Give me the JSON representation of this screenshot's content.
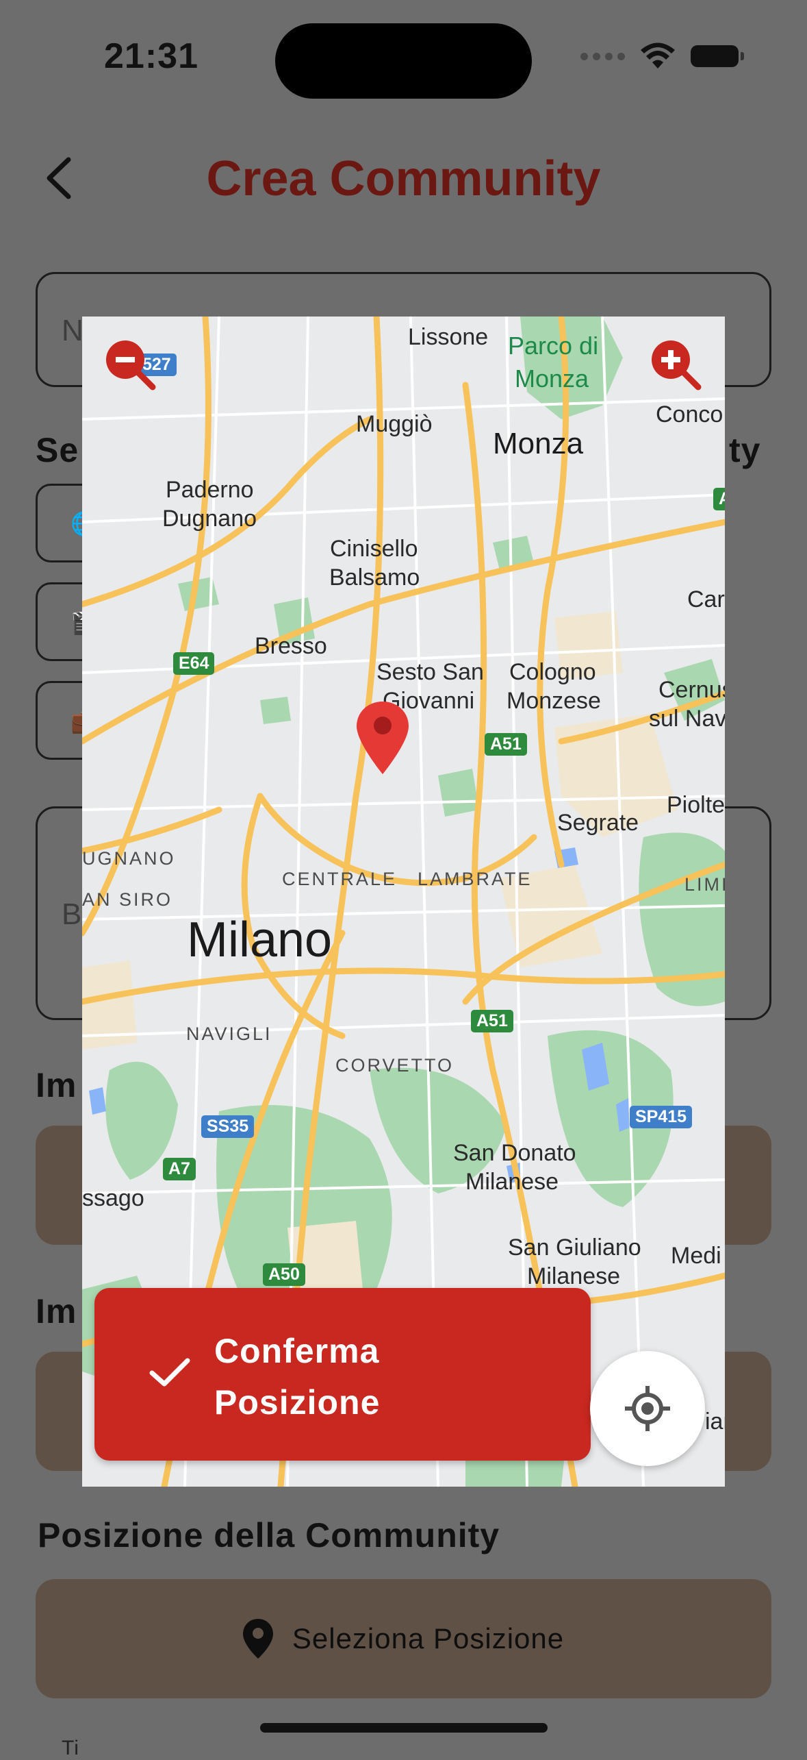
{
  "status_bar": {
    "time": "21:31"
  },
  "header": {
    "title": "Crea Community"
  },
  "form": {
    "name_placeholder": "N",
    "section_category_left": "Se",
    "section_category_right": "ty",
    "description_placeholder": "B",
    "section_image1": "Im",
    "section_image2": "Im",
    "section_position": "Posizione della Community",
    "select_position_label": "Seleziona Posizione",
    "bottom_partial": "Ti"
  },
  "map": {
    "labels": {
      "lissone": "Lissone",
      "parco1": "Parco di",
      "parco2": "Monza",
      "muggio": "Muggiò",
      "monza": "Monza",
      "conco": "Conco",
      "paderno1": "Paderno",
      "paderno2": "Dugnano",
      "cinisello1": "Cinisello",
      "cinisello2": "Balsamo",
      "car": "Car",
      "bresso": "Bresso",
      "sesto1": "Sesto San",
      "sesto2": "Giovanni",
      "cologno1": "Cologno",
      "cologno2": "Monzese",
      "cernus1": "Cernus",
      "cernus2": "sul Nav",
      "pioltello": "Piolte",
      "segrate": "Segrate",
      "ugnano": "UGNANO",
      "siro": "AN SIRO",
      "centrale": "CENTRALE",
      "lambrate": "LAMBRATE",
      "lim": "LIMI",
      "milano": "Milano",
      "navigli": "NAVIGLI",
      "corvetto": "CORVETTO",
      "donato1": "San Donato",
      "donato2": "Milanese",
      "assago": "ssago",
      "giuliano1": "San Giuliano",
      "giuliano2": "Milanese",
      "medi": "Medi",
      "ian": "ian"
    },
    "shields": {
      "e64": "E64",
      "a51a": "A51",
      "a51b": "A51",
      "ss35": "SS35",
      "a7": "A7",
      "a50": "A50",
      "sp415": "SP415",
      "s27": "527",
      "a4": "A"
    },
    "confirm_line1": "Conferma",
    "confirm_line2": "Posizione"
  },
  "colors": {
    "accent_red": "#c8281f",
    "title_red": "#6b1712",
    "overlay_brown": "#5f5145"
  }
}
